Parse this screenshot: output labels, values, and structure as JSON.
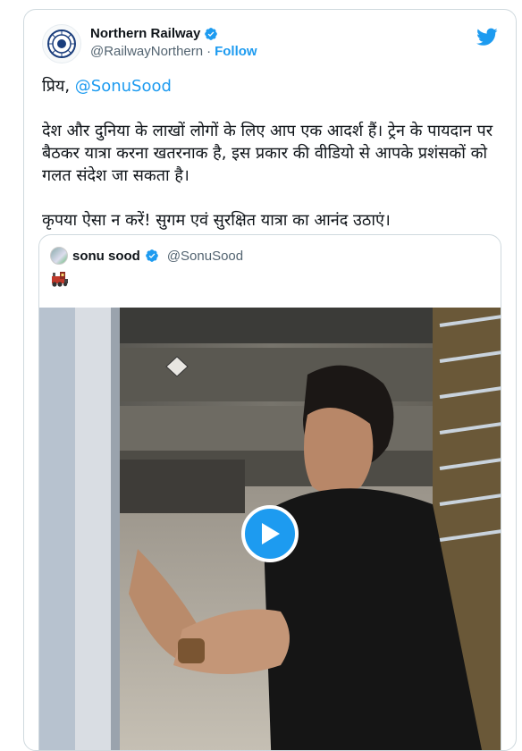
{
  "author": {
    "name": "Northern Railway",
    "handle": "@RailwayNorthern",
    "separator": "·",
    "follow_label": "Follow"
  },
  "icons": {
    "verified": "verified-badge-icon",
    "twitter": "twitter-bird-icon",
    "play": "play-icon",
    "train": "steam-locomotive-icon"
  },
  "tweet": {
    "greeting": "प्रिय, ",
    "mention": "@SonuSood",
    "paragraph1": "देश और दुनिया के लाखों लोगों के लिए आप एक आदर्श हैं। ट्रेन के पायदान पर बैठकर यात्रा करना खतरनाक है, इस प्रकार की  वीडियो से आपके प्रशंसकों को गलत संदेश जा सकता है।",
    "paragraph2": "कृपया ऐसा न करें! सुगम एवं सुरक्षित यात्रा का आनंद उठाएं।"
  },
  "quoted_tweet": {
    "name": "sonu sood",
    "handle": "@SonuSood"
  },
  "colors": {
    "accent": "#1d9bf0",
    "text": "#0f1419",
    "secondary": "#536471",
    "border": "#cfd9de"
  }
}
